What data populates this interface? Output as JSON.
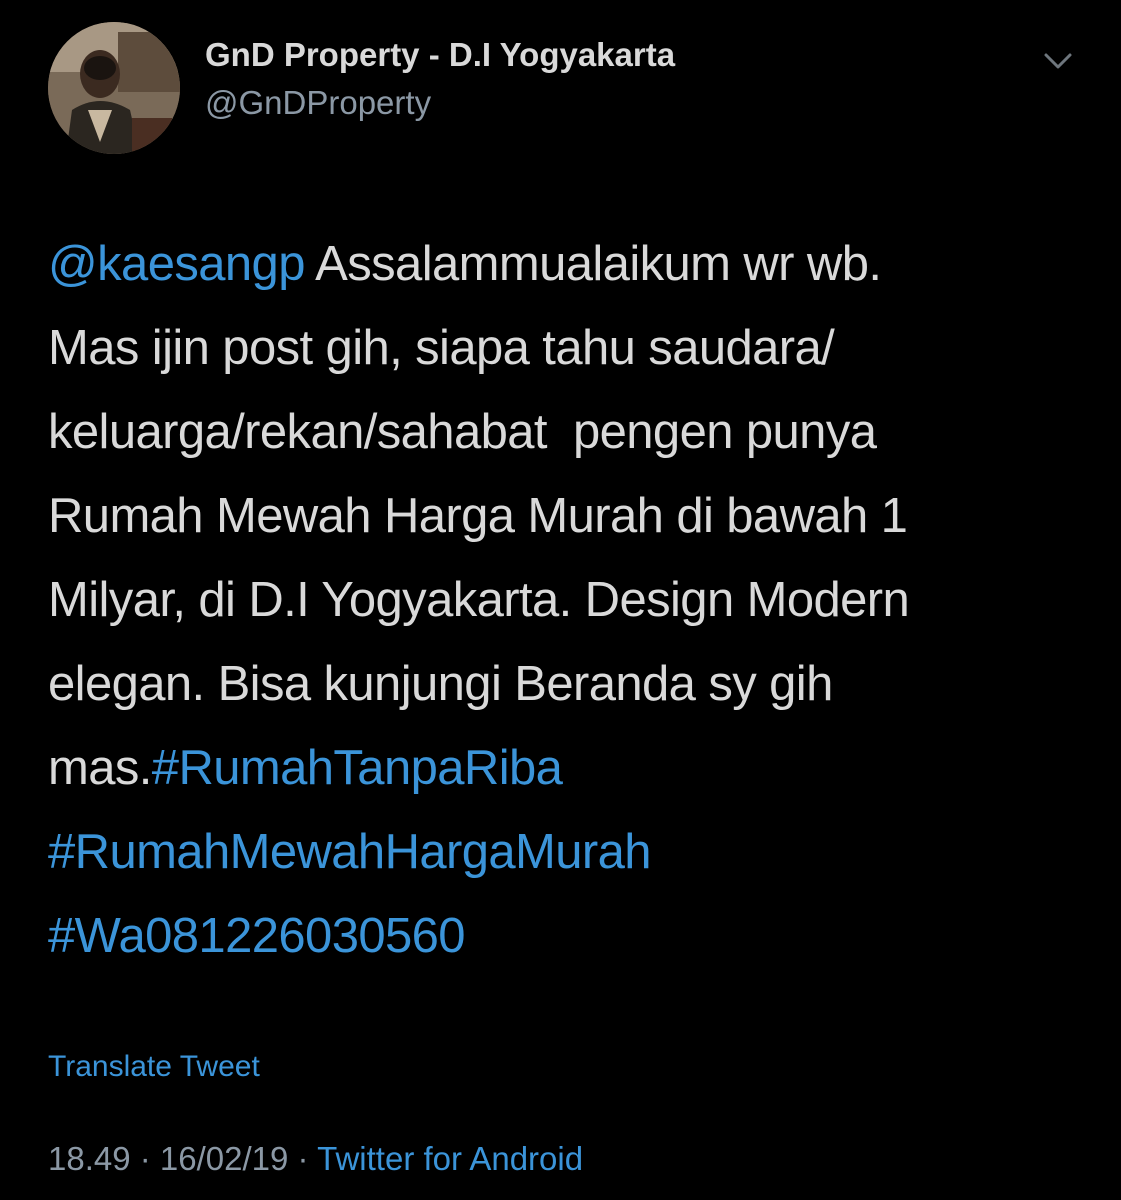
{
  "user": {
    "display_name": "GnD Property - D.I Yogyakarta",
    "handle": "@GnDProperty",
    "avatar_icon": "profile-photo"
  },
  "tweet": {
    "mention": "@kaesangp",
    "line1_rest": " Assalammualaikum wr wb.",
    "line2": "Mas ijin post gih, siapa tahu saudara/",
    "line3": "keluarga/rekan/sahabat  pengen punya",
    "line4": "Rumah Mewah Harga Murah di bawah 1",
    "line5": "Milyar, di D.I Yogyakarta. Design Modern",
    "line6": "elegan. Bisa kunjungi Beranda sy gih",
    "line7_prefix": "mas.",
    "hashtag1": "#RumahTanpaRiba",
    "hashtag2": "#RumahMewahHargaMurah",
    "hashtag3": "#Wa081226030560"
  },
  "translate_label": "Translate Tweet",
  "meta": {
    "time": "18.49",
    "separator": " · ",
    "date": "16/02/19",
    "source": "Twitter for Android"
  },
  "colors": {
    "background": "#000000",
    "text": "#d9d9d9",
    "secondary": "#8b98a5",
    "link": "#3b94d9"
  },
  "icons": {
    "menu": "chevron-down-icon"
  }
}
